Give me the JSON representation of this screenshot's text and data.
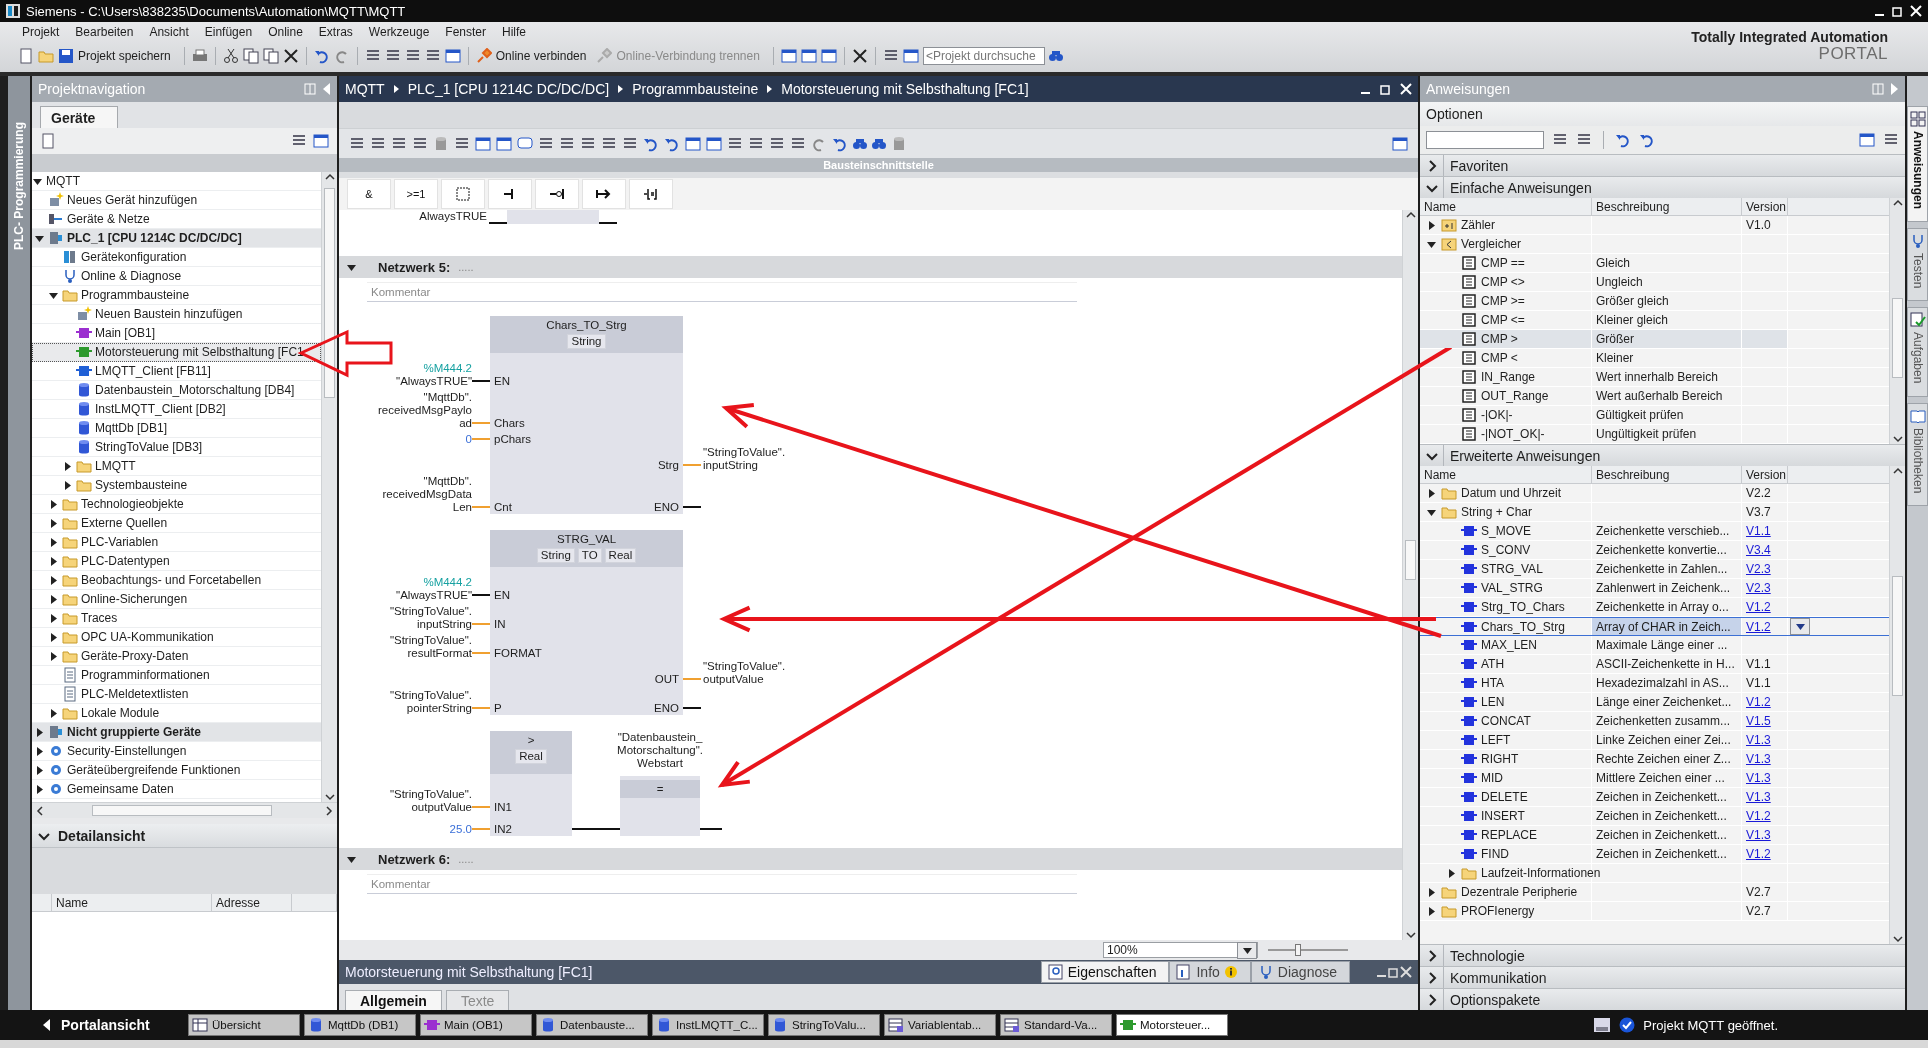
{
  "title_bar": {
    "title": "Siemens  -  C:\\Users\\838235\\Documents\\Automation\\MQTT\\MQTT"
  },
  "menu": [
    "Projekt",
    "Bearbeiten",
    "Ansicht",
    "Einfügen",
    "Online",
    "Extras",
    "Werkzeuge",
    "Fenster",
    "Hilfe"
  ],
  "toolbar": {
    "save": "Projekt speichern",
    "connect": "Online verbinden",
    "disconnect": {
      "label": "Online-Verbindung trennen",
      "disabled": true
    },
    "search": {
      "placeholder": "<Projekt durchsuche"
    }
  },
  "brand": {
    "line1": "Totally Integrated Automation",
    "line2": "PORTAL"
  },
  "side_strip": {
    "label": "PLC- Programmierung"
  },
  "project_navigation": {
    "title": "Projektnavigation",
    "tab": {
      "label": "Geräte",
      "selected": true
    },
    "tree": [
      {
        "label": "MQTT",
        "expanded": true,
        "selected": false,
        "children": [
          {
            "label": "Neues Gerät hinzufügen",
            "kind": "add",
            "selected": false
          },
          {
            "label": "Geräte & Netze",
            "kind": "network",
            "selected": false
          },
          {
            "label": "PLC_1 [CPU 1214C DC/DC/DC]",
            "kind": "device",
            "expanded": true,
            "selected": false,
            "children": [
              {
                "label": "Gerätekonfiguration",
                "kind": "config",
                "selected": false
              },
              {
                "label": "Online & Diagnose",
                "kind": "diagnose",
                "selected": false
              },
              {
                "label": "Programmbausteine",
                "kind": "folder",
                "expanded": true,
                "selected": false,
                "children": [
                  {
                    "label": "Neuen Baustein hinzufügen",
                    "kind": "add",
                    "selected": false
                  },
                  {
                    "label": "Main [OB1]",
                    "kind": "ob",
                    "selected": false
                  },
                  {
                    "label": "Motorsteuerung mit Selbsthaltung [FC1",
                    "kind": "fc",
                    "selected": true
                  },
                  {
                    "label": "LMQTT_Client [FB11]",
                    "kind": "fb",
                    "selected": false
                  },
                  {
                    "label": "Datenbaustein_Motorschaltung [DB4]",
                    "kind": "db",
                    "selected": false
                  },
                  {
                    "label": "InstLMQTT_Client [DB2]",
                    "kind": "db",
                    "selected": false
                  },
                  {
                    "label": "MqttDb [DB1]",
                    "kind": "db",
                    "selected": false
                  },
                  {
                    "label": "StringToValue [DB3]",
                    "kind": "db",
                    "selected": false
                  },
                  {
                    "label": "LMQTT",
                    "kind": "folder",
                    "expanded": false,
                    "selected": false
                  },
                  {
                    "label": "Systembausteine",
                    "kind": "folder",
                    "expanded": false,
                    "selected": false
                  }
                ]
              },
              {
                "label": "Technologieobjekte",
                "kind": "folder",
                "expanded": false,
                "selected": false
              },
              {
                "label": "Externe Quellen",
                "kind": "folder",
                "expanded": false,
                "selected": false
              },
              {
                "label": "PLC-Variablen",
                "kind": "folder",
                "expanded": false,
                "selected": false
              },
              {
                "label": "PLC-Datentypen",
                "kind": "folder",
                "expanded": false,
                "selected": false
              },
              {
                "label": "Beobachtungs- und Forcetabellen",
                "kind": "folder",
                "expanded": false,
                "selected": false
              },
              {
                "label": "Online-Sicherungen",
                "kind": "folder",
                "expanded": false,
                "selected": false
              },
              {
                "label": "Traces",
                "kind": "folder",
                "expanded": false,
                "selected": false
              },
              {
                "label": "OPC UA-Kommunikation",
                "kind": "folder",
                "expanded": false,
                "selected": false
              },
              {
                "label": "Geräte-Proxy-Daten",
                "kind": "folder",
                "expanded": false,
                "selected": false
              },
              {
                "label": "Programminformationen",
                "kind": "document",
                "selected": false
              },
              {
                "label": "PLC-Meldetextlisten",
                "kind": "document",
                "selected": false
              },
              {
                "label": "Lokale Module",
                "kind": "folder",
                "expanded": false,
                "selected": false
              }
            ]
          },
          {
            "label": "Nicht gruppierte Geräte",
            "kind": "device",
            "expanded": false,
            "selected": false
          },
          {
            "label": "Security-Einstellungen",
            "kind": "settings",
            "expanded": false,
            "selected": false
          },
          {
            "label": "Geräteübergreifende Funktionen",
            "kind": "settings",
            "expanded": false,
            "selected": false
          },
          {
            "label": "Gemeinsame Daten",
            "kind": "settings",
            "expanded": false,
            "selected": false
          }
        ]
      }
    ],
    "detail": {
      "title": "Detailansicht",
      "expanded": true,
      "columns": [
        "Name",
        "Adresse"
      ]
    }
  },
  "editor": {
    "breadcrumb": [
      "MQTT",
      "PLC_1 [CPU 1214C DC/DC/DC]",
      "Programmbausteine",
      "Motorsteuerung mit Selbsthaltung [FC1]"
    ],
    "interface_bar": "Bausteinschnittstelle",
    "instruction_keys": [
      "&",
      ">=1"
    ],
    "previous_operand": "AlwaysTRUE",
    "networks": [
      {
        "title": "Netzwerk 5:",
        "dots": ".....",
        "expanded": true,
        "comment": {
          "placeholder": "Kommentar"
        },
        "blocks": [
          {
            "title": "Chars_TO_Strg",
            "types": [
              "String"
            ],
            "rows": [
              {
                "address": "%M444.2",
                "operand": "\"AlwaysTRUE\"",
                "constant": false,
                "kind": "enable",
                "pin": "EN"
              },
              {
                "operand": "\"MqttDb\".\nreceivedMsgPaylo\nad",
                "constant": false,
                "kind": "data",
                "pin": "Chars"
              },
              {
                "operand": "0",
                "constant": true,
                "kind": "data",
                "pin": "pChars"
              },
              {
                "pin_out": "Strg",
                "out_enable": false,
                "out_operand": "\"StringToValue\".\ninputString"
              },
              {
                "operand": "\"MqttDb\".\nreceivedMsgData\nLen",
                "constant": false,
                "kind": "data",
                "pin": "Cnt",
                "pin_out": "ENO",
                "out_enable": true
              }
            ]
          },
          {
            "title": "STRG_VAL",
            "types": [
              "String",
              "TO",
              "Real"
            ],
            "rows": [
              {
                "address": "%M444.2",
                "operand": "\"AlwaysTRUE\"",
                "constant": false,
                "kind": "enable",
                "pin": "EN"
              },
              {
                "operand": "\"StringToValue\".\ninputString",
                "constant": false,
                "kind": "data",
                "pin": "IN"
              },
              {
                "operand": "\"StringToValue\".\nresultFormat",
                "constant": false,
                "kind": "data",
                "pin": "FORMAT"
              },
              {
                "pin_out": "OUT",
                "out_enable": false,
                "out_operand": "\"StringToValue\".\noutputValue"
              },
              {
                "operand": "\"StringToValue\".\npointerString",
                "constant": false,
                "kind": "data",
                "pin": "P",
                "pin_out": "ENO",
                "out_enable": true
              }
            ]
          },
          {
            "title": ">",
            "types": [
              "Real"
            ],
            "rows": [
              {
                "operand": "\"StringToValue\".\noutputValue",
                "constant": false,
                "kind": "data",
                "pin": "IN1"
              },
              {
                "operand": "25.0",
                "constant": true,
                "kind": "data",
                "pin": "IN2"
              }
            ],
            "coil": {
              "operand": "\"Datenbaustein_\nMotorschaltung\".\nWebstart",
              "symbol": "="
            }
          }
        ]
      },
      {
        "title": "Netzwerk 6:",
        "dots": ".....",
        "expanded": true,
        "comment": {
          "placeholder": "Kommentar"
        }
      }
    ],
    "zoom": "100%",
    "zoom_slider": {
      "level": 0.38
    }
  },
  "inspector": {
    "title": "Motorsteuerung mit Selbsthaltung [FC1]",
    "tabs": [
      {
        "label": "Eigenschaften",
        "kind": "properties",
        "selected": true
      },
      {
        "label": "Info",
        "kind": "info",
        "selected": false
      },
      {
        "label": "Diagnose",
        "kind": "diagnose",
        "selected": false
      }
    ],
    "subtabs": [
      {
        "label": "Allgemein",
        "selected": true
      },
      {
        "label": "Texte",
        "selected": false
      }
    ]
  },
  "instructions_panel": {
    "title": "Anweisungen",
    "options": "Optionen",
    "sections": [
      {
        "title": "Favoriten",
        "expanded": false
      },
      {
        "title": "Einfache Anweisungen",
        "expanded": true,
        "focused": false,
        "columns": [
          "Name",
          "Beschreibung",
          "Version"
        ],
        "rows": [
          {
            "name": "Zähler",
            "kind": "counter_folder",
            "expanded": false,
            "version": "V1.0",
            "link": false,
            "selected": false
          },
          {
            "name": "Vergleicher",
            "kind": "compare_folder",
            "expanded": true,
            "selected": false,
            "children": [
              {
                "name": "CMP ==",
                "kind": "instruction",
                "description": "Gleich",
                "selected": false
              },
              {
                "name": "CMP <>",
                "kind": "instruction",
                "description": "Ungleich",
                "selected": false
              },
              {
                "name": "CMP >=",
                "kind": "instruction",
                "description": "Größer gleich",
                "selected": false
              },
              {
                "name": "CMP <=",
                "kind": "instruction",
                "description": "Kleiner gleich",
                "selected": false
              },
              {
                "name": "CMP >",
                "kind": "instruction",
                "description": "Größer",
                "selected": true
              },
              {
                "name": "CMP <",
                "kind": "instruction",
                "description": "Kleiner",
                "selected": false
              },
              {
                "name": "IN_Range",
                "kind": "instruction",
                "description": "Wert innerhalb Bereich",
                "selected": false
              },
              {
                "name": "OUT_Range",
                "kind": "instruction",
                "description": "Wert außerhalb Bereich",
                "selected": false
              },
              {
                "name": "-|OK|-",
                "kind": "instruction",
                "description": "Gültigkeit prüfen",
                "selected": false
              },
              {
                "name": "-|NOT_OK|-",
                "kind": "instruction",
                "description": "Ungültigkeit prüfen",
                "selected": false
              }
            ]
          }
        ]
      },
      {
        "title": "Erweiterte Anweisungen",
        "expanded": true,
        "focused": true,
        "columns": [
          "Name",
          "Beschreibung",
          "Version"
        ],
        "rows": [
          {
            "name": "Datum und Uhrzeit",
            "kind": "folder",
            "expanded": false,
            "version": "V2.2",
            "link": false,
            "selected": false
          },
          {
            "name": "String + Char",
            "kind": "folder",
            "expanded": true,
            "version": "V3.7",
            "link": false,
            "selected": false,
            "children": [
              {
                "name": "S_MOVE",
                "kind": "function",
                "description": "Zeichenkette verschieb...",
                "version": "V1.1",
                "link": true,
                "selected": false
              },
              {
                "name": "S_CONV",
                "kind": "function",
                "description": "Zeichenkette konvertie...",
                "version": "V3.4",
                "link": true,
                "selected": false
              },
              {
                "name": "STRG_VAL",
                "kind": "function",
                "description": "Zeichenkette in Zahlen...",
                "version": "V2.3",
                "link": true,
                "selected": false
              },
              {
                "name": "VAL_STRG",
                "kind": "function",
                "description": "Zahlenwert in Zeichenk...",
                "version": "V2.3",
                "link": true,
                "selected": false
              },
              {
                "name": "Strg_TO_Chars",
                "kind": "function",
                "description": "Zeichenkette in Array o...",
                "version": "V1.2",
                "link": true,
                "selected": false
              },
              {
                "name": "Chars_TO_Strg",
                "kind": "function",
                "description": "Array of CHAR in Zeich...",
                "version": "V1.2",
                "link": true,
                "selected": true
              },
              {
                "name": "MAX_LEN",
                "kind": "function",
                "description": "Maximale Länge einer ...",
                "selected": false
              },
              {
                "name": "ATH",
                "kind": "function",
                "description": "ASCII-Zeichenkette in H...",
                "version": "V1.1",
                "link": false,
                "selected": false
              },
              {
                "name": "HTA",
                "kind": "function",
                "description": "Hexadezimalzahl in AS...",
                "version": "V1.1",
                "link": false,
                "selected": false
              },
              {
                "name": "LEN",
                "kind": "function",
                "description": "Länge einer Zeichenket...",
                "version": "V1.2",
                "link": true,
                "selected": false
              },
              {
                "name": "CONCAT",
                "kind": "function",
                "description": "Zeichenketten zusamm...",
                "version": "V1.5",
                "link": true,
                "selected": false
              },
              {
                "name": "LEFT",
                "kind": "function",
                "description": "Linke Zeichen einer Zei...",
                "version": "V1.3",
                "link": true,
                "selected": false
              },
              {
                "name": "RIGHT",
                "kind": "function",
                "description": "Rechte Zeichen einer Z...",
                "version": "V1.3",
                "link": true,
                "selected": false
              },
              {
                "name": "MID",
                "kind": "function",
                "description": "Mittlere Zeichen einer ...",
                "version": "V1.3",
                "link": true,
                "selected": false
              },
              {
                "name": "DELETE",
                "kind": "function",
                "description": "Zeichen in Zeichenkett...",
                "version": "V1.3",
                "link": true,
                "selected": false
              },
              {
                "name": "INSERT",
                "kind": "function",
                "description": "Zeichen in Zeichenkett...",
                "version": "V1.2",
                "link": true,
                "selected": false
              },
              {
                "name": "REPLACE",
                "kind": "function",
                "description": "Zeichen in Zeichenkett...",
                "version": "V1.3",
                "link": true,
                "selected": false
              },
              {
                "name": "FIND",
                "kind": "function",
                "description": "Zeichen in Zeichenkett...",
                "version": "V1.2",
                "link": true,
                "selected": false
              },
              {
                "name": "Laufzeit-Informationen",
                "kind": "folder",
                "expanded": false,
                "selected": false
              }
            ]
          },
          {
            "name": "Dezentrale Peripherie",
            "kind": "folder",
            "expanded": false,
            "version": "V2.7",
            "link": false,
            "selected": false
          },
          {
            "name": "PROFIenergy",
            "kind": "folder",
            "expanded": false,
            "version": "V2.7",
            "link": false,
            "selected": false
          }
        ]
      },
      {
        "title": "Technologie",
        "expanded": false
      },
      {
        "title": "Kommunikation",
        "expanded": false
      },
      {
        "title": "Optionspakete",
        "expanded": false
      }
    ]
  },
  "side_tabs": [
    {
      "label": "Anweisungen",
      "kind": "instructions",
      "selected": true
    },
    {
      "label": "Testen",
      "kind": "testing",
      "selected": false
    },
    {
      "label": "Aufgaben",
      "kind": "tasks",
      "selected": false
    },
    {
      "label": "Bibliotheken",
      "kind": "libraries",
      "selected": false
    }
  ],
  "taskbar": {
    "portal": "Portalansicht",
    "items": [
      {
        "label": "Übersicht",
        "kind": "overview",
        "selected": false
      },
      {
        "label": "MqttDb (DB1)",
        "kind": "db",
        "selected": false
      },
      {
        "label": "Main (OB1)",
        "kind": "ob",
        "selected": false
      },
      {
        "label": "Datenbauste...",
        "kind": "db",
        "selected": false
      },
      {
        "label": "InstLMQTT_C...",
        "kind": "db",
        "selected": false
      },
      {
        "label": "StringToValu...",
        "kind": "db",
        "selected": false
      },
      {
        "label": "Variablentab...",
        "kind": "table",
        "selected": false
      },
      {
        "label": "Standard-Va...",
        "kind": "table",
        "selected": false
      },
      {
        "label": "Motorsteuer...",
        "kind": "fc",
        "selected": true
      }
    ],
    "status": "Projekt MQTT geöffnet."
  }
}
